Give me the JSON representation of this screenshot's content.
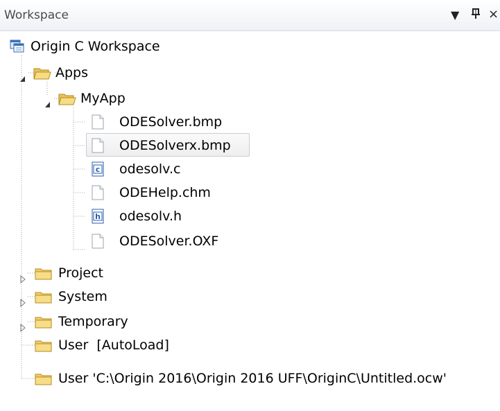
{
  "panel": {
    "title": "Workspace",
    "menu_glyph": "▼",
    "pin_glyph": "ᵖ",
    "close_glyph": "×"
  },
  "tree": {
    "root": "Origin C Workspace",
    "apps": "Apps",
    "myapp": "MyApp",
    "files": [
      {
        "label": "ODESolver.bmp",
        "icon": "file-icon"
      },
      {
        "label": "ODESolverx.bmp",
        "icon": "file-icon",
        "selected": true
      },
      {
        "label": "odesolv.c",
        "icon": "c-file-icon"
      },
      {
        "label": "ODEHelp.chm",
        "icon": "file-icon"
      },
      {
        "label": "odesolv.h",
        "icon": "h-file-icon"
      },
      {
        "label": "ODESolver.OXF",
        "icon": "file-icon"
      }
    ],
    "folders": [
      {
        "label": "Project"
      },
      {
        "label": "System"
      },
      {
        "label": "Temporary"
      },
      {
        "label": "User  [AutoLoad]"
      },
      {
        "label": "User 'C:\\Origin 2016\\Origin 2016 UFF\\OriginC\\Untitled.ocw'"
      }
    ]
  }
}
